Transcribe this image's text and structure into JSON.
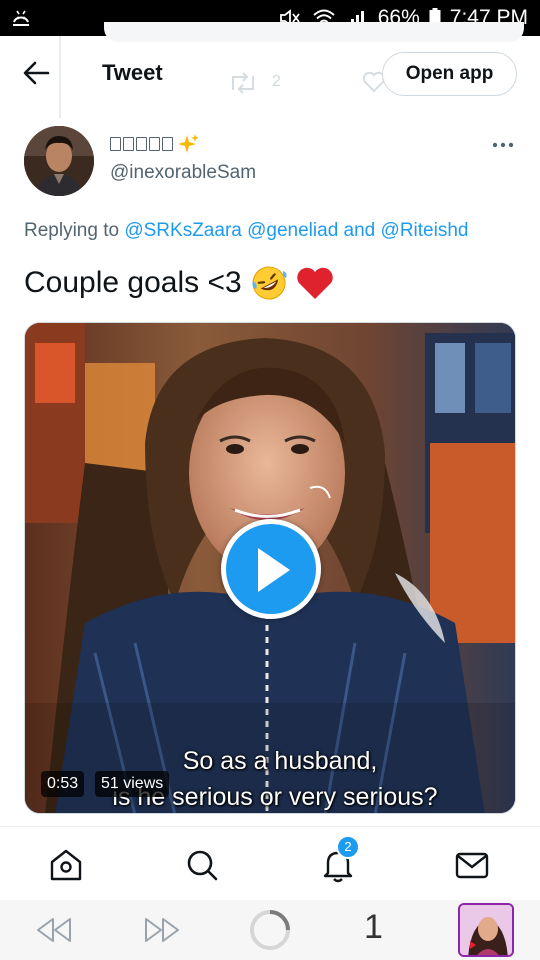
{
  "status_bar": {
    "battery": "66%",
    "time": "7:47 PM",
    "icons": [
      "usb-debug-icon",
      "mute-icon",
      "wifi-icon",
      "signal-icon",
      "battery-icon"
    ]
  },
  "header": {
    "title": "Tweet",
    "open_app_label": "Open app",
    "ghost_retweet_count": "2"
  },
  "tweet": {
    "handle": "@inexorableSam",
    "display_name_emoji": "✨",
    "replying_prefix": "Replying to ",
    "mentions": [
      "@SRKsZaara",
      "@geneliad"
    ],
    "mention_join": " and ",
    "last_mention": "@Riteishd",
    "text": "Couple goals <3",
    "emojis": [
      "rolling-on-floor-laughing",
      "red-heart"
    ]
  },
  "media": {
    "duration": "0:53",
    "views": "51 views",
    "subtitle_line1": "So as a husband,",
    "subtitle_line2": "is he serious or very serious?"
  },
  "bottom_nav": {
    "items": [
      "home-icon",
      "search-icon",
      "notifications-icon",
      "messages-icon"
    ],
    "notification_count": "2"
  },
  "browser_bar": {
    "tab_count": "1"
  },
  "colors": {
    "accent": "#1d9bf0",
    "text_primary": "#0f1419",
    "text_secondary": "#536471",
    "tab_border": "#8e24aa"
  }
}
